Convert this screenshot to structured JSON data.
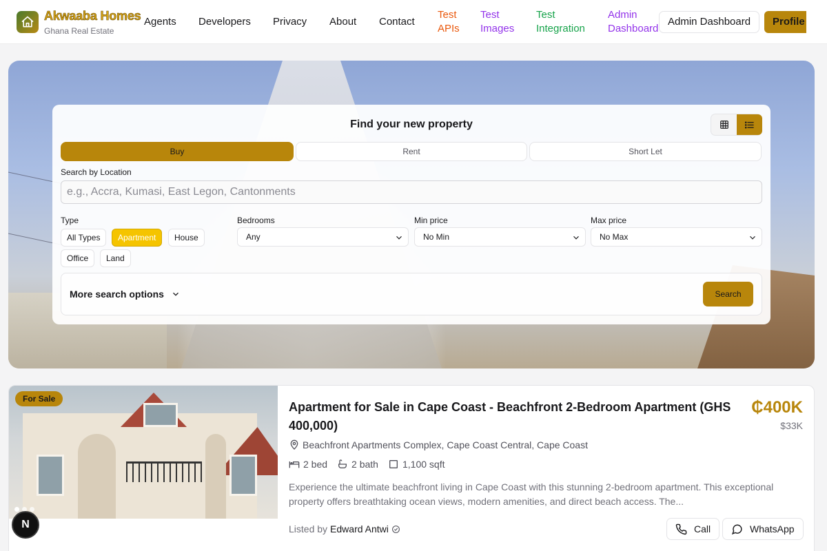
{
  "nav": {
    "brand": "Akwaaba Homes",
    "brand_sub": "Ghana Real Estate",
    "links": [
      "Agents",
      "Developers",
      "Privacy",
      "About",
      "Contact"
    ],
    "test_links": [
      {
        "line1": "Test",
        "line2": "APIs",
        "color": "#ea580c"
      },
      {
        "line1": "Test",
        "line2": "Images",
        "color": "#9333ea"
      },
      {
        "line1": "Test",
        "line2": "Integration",
        "color": "#16a34a"
      },
      {
        "line1": "Admin",
        "line2": "Dashboard",
        "color": "#9333ea"
      }
    ],
    "admin_button": "Admin Dashboard",
    "profile_button": "Profile"
  },
  "search": {
    "title": "Find your new property",
    "tabs": [
      "Buy",
      "Rent",
      "Short Let"
    ],
    "active_tab": "Buy",
    "location_label": "Search by Location",
    "location_placeholder": "e.g., Accra, Kumasi, East Legon, Cantonments",
    "type_label": "Type",
    "types": [
      "All Types",
      "Apartment",
      "House",
      "Office",
      "Land"
    ],
    "active_type": "Apartment",
    "bedrooms_label": "Bedrooms",
    "bedrooms_value": "Any",
    "min_price_label": "Min price",
    "min_price_value": "No Min",
    "max_price_label": "Max price",
    "max_price_value": "No Max",
    "more_options": "More search options",
    "search_button": "Search",
    "view_modes": [
      "grid-icon",
      "list-icon"
    ],
    "active_view": "list-icon"
  },
  "listing": {
    "badge": "For Sale",
    "title": "Apartment for Sale in Cape Coast - Beachfront 2-Bedroom Apartment (GHS 400,000)",
    "price": "₵400K",
    "price_usd": "$33K",
    "location": "Beachfront Apartments Complex, Cape Coast Central, Cape Coast",
    "beds": "2 bed",
    "baths": "2 bath",
    "area": "1,100 sqft",
    "description": "Experience the ultimate beachfront living in Cape Coast with this stunning 2-bedroom apartment. This exceptional property offers breathtaking ocean views, modern amenities, and direct beach access. The...",
    "listed_by_label": "Listed by",
    "agent": "Edward Antwi",
    "call_button": "Call",
    "whatsapp_button": "WhatsApp",
    "image_count": 3,
    "active_image": 1
  },
  "dev_badge": "N",
  "colors": {
    "accent": "#b8860b",
    "chip_active": "#f5c400",
    "brand": "#d6a418"
  }
}
